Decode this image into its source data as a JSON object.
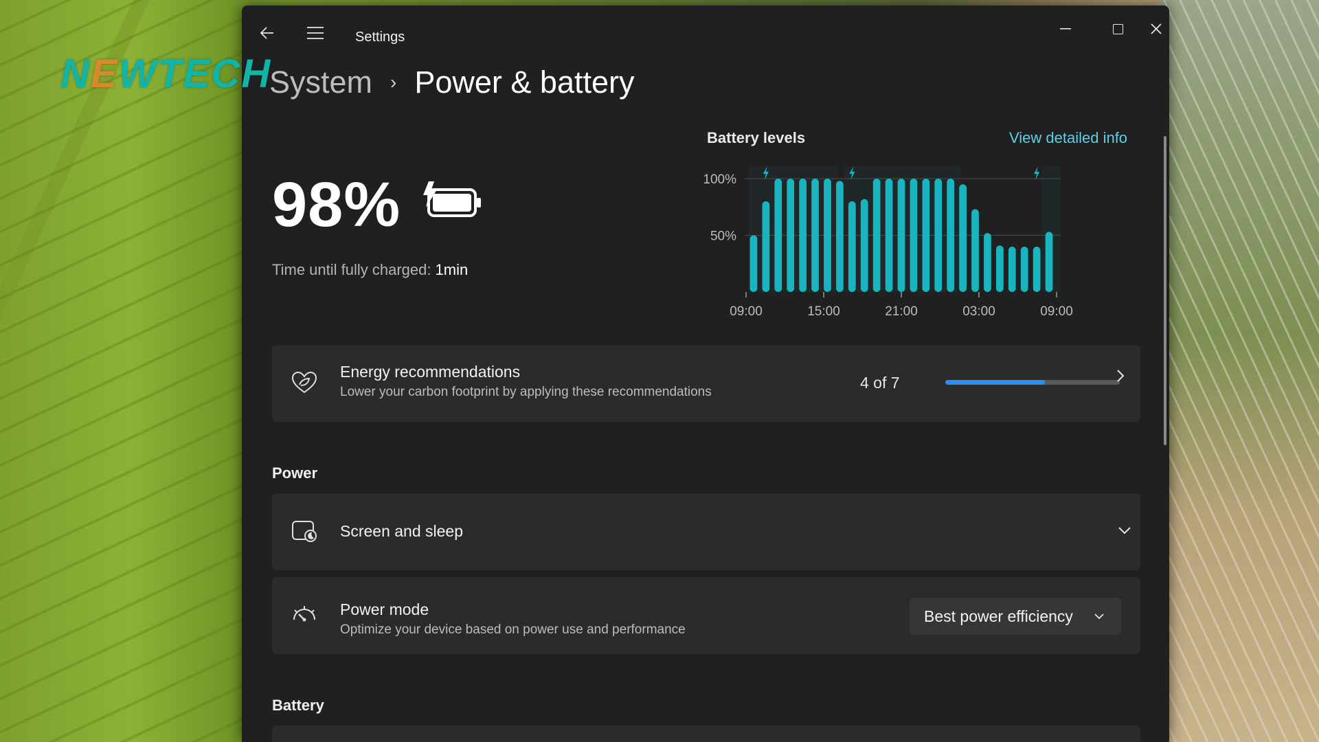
{
  "watermark": {
    "text_n": "N",
    "text_e": "E",
    "text_rest": "WTECH"
  },
  "window": {
    "title": "Settings"
  },
  "breadcrumb": {
    "parent": "System",
    "separator": "›",
    "current": "Power & battery"
  },
  "battery": {
    "percent_text": "98%",
    "time_label": "Time until fully charged:",
    "time_value": "1min"
  },
  "battery_chart": {
    "title": "Battery levels",
    "link": "View detailed info"
  },
  "chart_data": {
    "type": "bar",
    "title": "Battery levels",
    "ylabel": "",
    "xlabel": "",
    "ylim": [
      0,
      100
    ],
    "ytick_labels": [
      "100%",
      "50%"
    ],
    "yticks": [
      100,
      50
    ],
    "xtick_labels": [
      "09:00",
      "15:00",
      "21:00",
      "03:00",
      "09:00"
    ],
    "values": [
      50,
      80,
      100,
      100,
      100,
      100,
      100,
      98,
      80,
      82,
      100,
      100,
      100,
      100,
      100,
      100,
      100,
      95,
      73,
      52,
      41,
      40,
      40,
      40,
      53
    ],
    "charging_markers": [
      1,
      8,
      23
    ],
    "bar_color": "#19b4c0",
    "grid": true
  },
  "energy_recommendations": {
    "title": "Energy recommendations",
    "subtitle": "Lower your carbon footprint by applying these recommendations",
    "progress_text": "4 of 7",
    "progress_fraction": 0.571,
    "icon": "leaf-heart-icon"
  },
  "power_section": {
    "label": "Power",
    "screen_sleep": {
      "title": "Screen and sleep",
      "icon": "screen-sleep-icon"
    },
    "power_mode": {
      "title": "Power mode",
      "subtitle": "Optimize your device based on power use and performance",
      "selected": "Best power efficiency",
      "icon": "gauge-icon"
    }
  },
  "battery_section": {
    "label": "Battery"
  },
  "colors": {
    "accent": "#2f8df1",
    "chart_bar": "#19b4c0",
    "link": "#5cd1e6",
    "window_bg": "#202020",
    "card_bg": "#2b2b2b"
  }
}
